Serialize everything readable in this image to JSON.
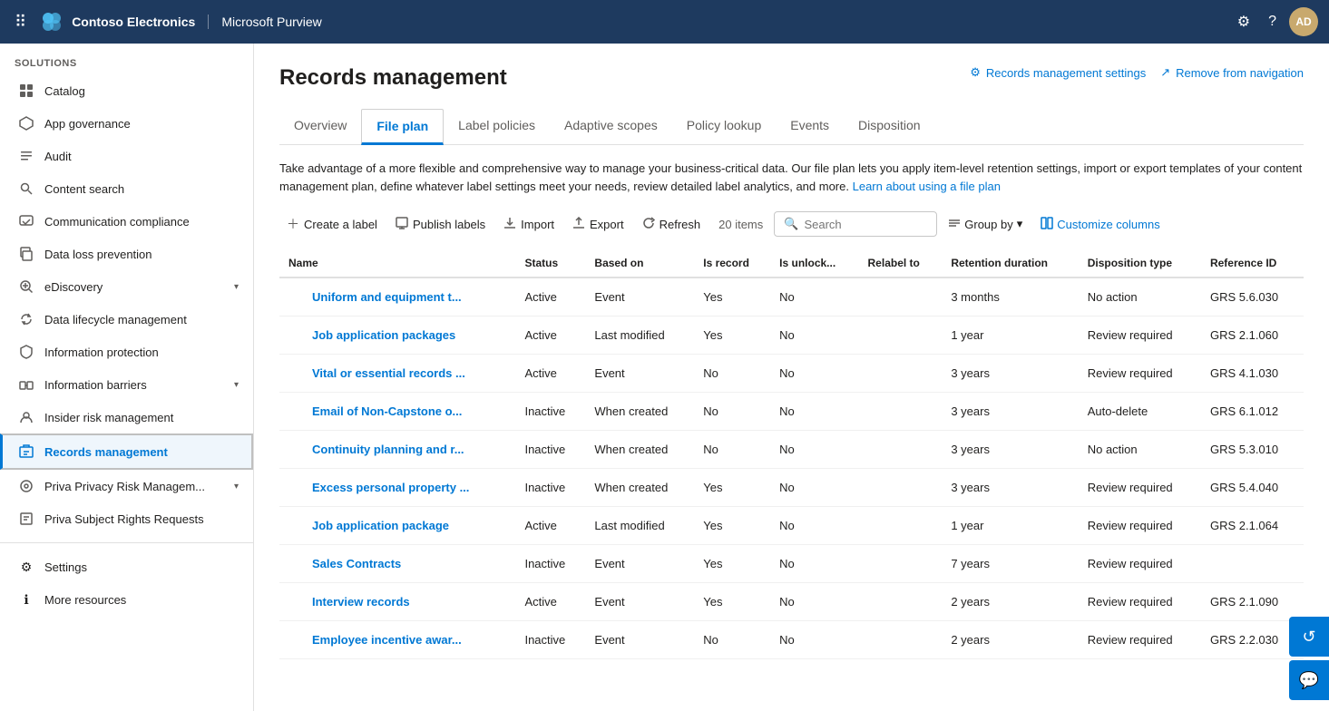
{
  "topnav": {
    "brand": "Contoso Electronics",
    "app": "Microsoft Purview",
    "avatar_initials": "AD"
  },
  "sidebar": {
    "section_label": "Solutions",
    "items": [
      {
        "id": "catalog",
        "label": "Catalog",
        "icon": "⊞",
        "active": false
      },
      {
        "id": "app-governance",
        "label": "App governance",
        "icon": "⬡",
        "active": false
      },
      {
        "id": "audit",
        "label": "Audit",
        "icon": "☰",
        "active": false
      },
      {
        "id": "content-search",
        "label": "Content search",
        "icon": "🔍",
        "active": false
      },
      {
        "id": "communication-compliance",
        "label": "Communication compliance",
        "icon": "⊞",
        "active": false
      },
      {
        "id": "data-loss-prevention",
        "label": "Data loss prevention",
        "icon": "⊞",
        "active": false
      },
      {
        "id": "ediscovery",
        "label": "eDiscovery",
        "icon": "⊞",
        "active": false,
        "has_chevron": true
      },
      {
        "id": "data-lifecycle",
        "label": "Data lifecycle management",
        "icon": "⊞",
        "active": false
      },
      {
        "id": "information-protection",
        "label": "Information protection",
        "icon": "⊞",
        "active": false
      },
      {
        "id": "information-barriers",
        "label": "Information barriers",
        "icon": "⊞",
        "active": false,
        "has_chevron": true
      },
      {
        "id": "insider-risk",
        "label": "Insider risk management",
        "icon": "⊞",
        "active": false
      },
      {
        "id": "records-management",
        "label": "Records management",
        "icon": "⊞",
        "active": true
      },
      {
        "id": "priva-privacy",
        "label": "Priva Privacy Risk Managem...",
        "icon": "⊞",
        "active": false,
        "has_chevron": true
      },
      {
        "id": "priva-subject",
        "label": "Priva Subject Rights Requests",
        "icon": "⊞",
        "active": false
      }
    ],
    "bottom_items": [
      {
        "id": "settings",
        "label": "Settings",
        "icon": "⚙"
      },
      {
        "id": "more-resources",
        "label": "More resources",
        "icon": "ℹ"
      }
    ]
  },
  "page": {
    "title": "Records management",
    "header_actions": [
      {
        "id": "rm-settings",
        "label": "Records management settings",
        "icon": "⚙"
      },
      {
        "id": "remove-nav",
        "label": "Remove from navigation",
        "icon": "↗"
      }
    ]
  },
  "tabs": [
    {
      "id": "overview",
      "label": "Overview",
      "active": false
    },
    {
      "id": "file-plan",
      "label": "File plan",
      "active": true
    },
    {
      "id": "label-policies",
      "label": "Label policies",
      "active": false
    },
    {
      "id": "adaptive-scopes",
      "label": "Adaptive scopes",
      "active": false
    },
    {
      "id": "policy-lookup",
      "label": "Policy lookup",
      "active": false
    },
    {
      "id": "events",
      "label": "Events",
      "active": false
    },
    {
      "id": "disposition",
      "label": "Disposition",
      "active": false
    }
  ],
  "description": {
    "text": "Take advantage of a more flexible and comprehensive way to manage your business-critical data. Our file plan lets you apply item-level retention settings, import or export templates of your content management plan, define whatever label settings meet your needs, review detailed label analytics, and more.",
    "link_text": "Learn about using a file plan"
  },
  "toolbar": {
    "create_label": "Create a label",
    "publish_labels": "Publish labels",
    "import": "Import",
    "export": "Export",
    "refresh": "Refresh",
    "item_count": "20 items",
    "search_placeholder": "Search",
    "group_by": "Group by",
    "customize_columns": "Customize columns"
  },
  "table": {
    "columns": [
      {
        "id": "name",
        "label": "Name"
      },
      {
        "id": "status",
        "label": "Status"
      },
      {
        "id": "based-on",
        "label": "Based on"
      },
      {
        "id": "is-record",
        "label": "Is record"
      },
      {
        "id": "is-unlock",
        "label": "Is unlock..."
      },
      {
        "id": "relabel-to",
        "label": "Relabel to"
      },
      {
        "id": "retention-duration",
        "label": "Retention duration"
      },
      {
        "id": "disposition-type",
        "label": "Disposition type"
      },
      {
        "id": "reference-id",
        "label": "Reference ID"
      }
    ],
    "rows": [
      {
        "name": "Uniform and equipment t...",
        "status": "Active",
        "based_on": "Event",
        "is_record": "Yes",
        "is_unlock": "No",
        "relabel_to": "",
        "retention_duration": "3 months",
        "disposition_type": "No action",
        "reference_id": "GRS 5.6.030"
      },
      {
        "name": "Job application packages",
        "status": "Active",
        "based_on": "Last modified",
        "is_record": "Yes",
        "is_unlock": "No",
        "relabel_to": "",
        "retention_duration": "1 year",
        "disposition_type": "Review required",
        "reference_id": "GRS 2.1.060"
      },
      {
        "name": "Vital or essential records ...",
        "status": "Active",
        "based_on": "Event",
        "is_record": "No",
        "is_unlock": "No",
        "relabel_to": "",
        "retention_duration": "3 years",
        "disposition_type": "Review required",
        "reference_id": "GRS 4.1.030"
      },
      {
        "name": "Email of Non-Capstone o...",
        "status": "Inactive",
        "based_on": "When created",
        "is_record": "No",
        "is_unlock": "No",
        "relabel_to": "",
        "retention_duration": "3 years",
        "disposition_type": "Auto-delete",
        "reference_id": "GRS 6.1.012"
      },
      {
        "name": "Continuity planning and r...",
        "status": "Inactive",
        "based_on": "When created",
        "is_record": "No",
        "is_unlock": "No",
        "relabel_to": "",
        "retention_duration": "3 years",
        "disposition_type": "No action",
        "reference_id": "GRS 5.3.010"
      },
      {
        "name": "Excess personal property ...",
        "status": "Inactive",
        "based_on": "When created",
        "is_record": "Yes",
        "is_unlock": "No",
        "relabel_to": "",
        "retention_duration": "3 years",
        "disposition_type": "Review required",
        "reference_id": "GRS 5.4.040"
      },
      {
        "name": "Job application package",
        "status": "Active",
        "based_on": "Last modified",
        "is_record": "Yes",
        "is_unlock": "No",
        "relabel_to": "",
        "retention_duration": "1 year",
        "disposition_type": "Review required",
        "reference_id": "GRS 2.1.064"
      },
      {
        "name": "Sales Contracts",
        "status": "Inactive",
        "based_on": "Event",
        "is_record": "Yes",
        "is_unlock": "No",
        "relabel_to": "",
        "retention_duration": "7 years",
        "disposition_type": "Review required",
        "reference_id": ""
      },
      {
        "name": "Interview records",
        "status": "Active",
        "based_on": "Event",
        "is_record": "Yes",
        "is_unlock": "No",
        "relabel_to": "",
        "retention_duration": "2 years",
        "disposition_type": "Review required",
        "reference_id": "GRS 2.1.090"
      },
      {
        "name": "Employee incentive awar...",
        "status": "Inactive",
        "based_on": "Event",
        "is_record": "No",
        "is_unlock": "No",
        "relabel_to": "",
        "retention_duration": "2 years",
        "disposition_type": "Review required",
        "reference_id": "GRS 2.2.030"
      }
    ]
  },
  "fab": {
    "icon": "↺",
    "icon2": "💬"
  }
}
